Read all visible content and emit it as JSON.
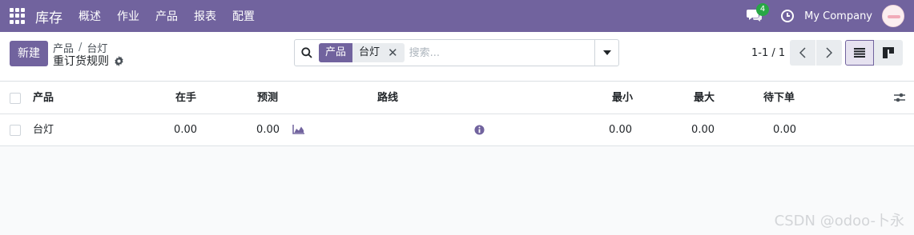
{
  "navbar": {
    "app_name": "库存",
    "menu": [
      "概述",
      "作业",
      "产品",
      "报表",
      "配置"
    ],
    "chat_count": "4",
    "company": "My Company"
  },
  "control": {
    "new_label": "新建",
    "breadcrumb": [
      "产品",
      "台灯"
    ],
    "page_title": "重订货规则",
    "search": {
      "facet_label": "产品",
      "facet_value": "台灯",
      "placeholder": "搜索..."
    },
    "pager": "1-1 / 1"
  },
  "table": {
    "columns": {
      "product": "产品",
      "on_hand": "在手",
      "forecast": "预测",
      "route": "路线",
      "min": "最小",
      "max": "最大",
      "to_order": "待下单"
    },
    "rows": [
      {
        "product": "台灯",
        "on_hand": "0.00",
        "forecast": "0.00",
        "min": "0.00",
        "max": "0.00",
        "to_order": "0.00"
      }
    ]
  },
  "colors": {
    "brand": "#71639e",
    "badge": "#28a745"
  },
  "watermark": "CSDN @odoo-卜永"
}
